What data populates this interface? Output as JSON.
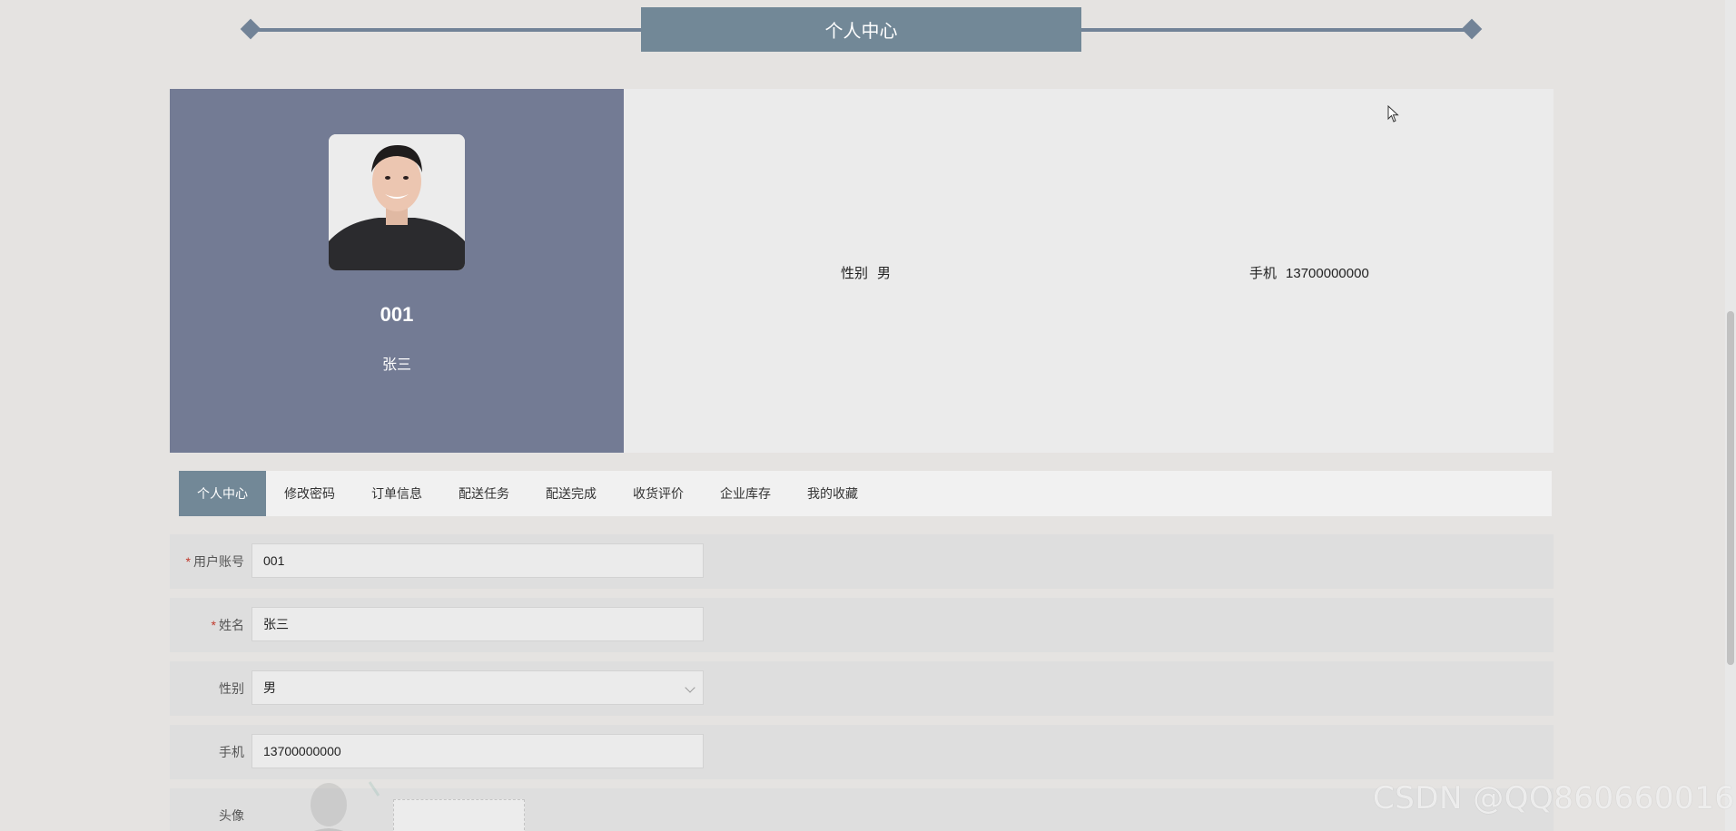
{
  "header": {
    "title": "个人中心"
  },
  "profile": {
    "account": "001",
    "name": "张三",
    "gender_label": "性别",
    "gender_value": "男",
    "phone_label": "手机",
    "phone_value": "13700000000"
  },
  "tabs": [
    {
      "label": "个人中心",
      "active": true
    },
    {
      "label": "修改密码"
    },
    {
      "label": "订单信息"
    },
    {
      "label": "配送任务"
    },
    {
      "label": "配送完成"
    },
    {
      "label": "收货评价"
    },
    {
      "label": "企业库存"
    },
    {
      "label": "我的收藏"
    }
  ],
  "form": {
    "account": {
      "label": "用户账号",
      "required": "*",
      "value": "001"
    },
    "name": {
      "label": "姓名",
      "required": "*",
      "value": "张三"
    },
    "gender": {
      "label": "性别",
      "value": "男"
    },
    "phone": {
      "label": "手机",
      "value": "13700000000"
    },
    "avatar": {
      "label": "头像"
    }
  },
  "watermark": "CSDN @QQ860660016",
  "colors": {
    "accent": "#728897",
    "profile_panel": "#737b94",
    "background": "#e5e3e1"
  }
}
